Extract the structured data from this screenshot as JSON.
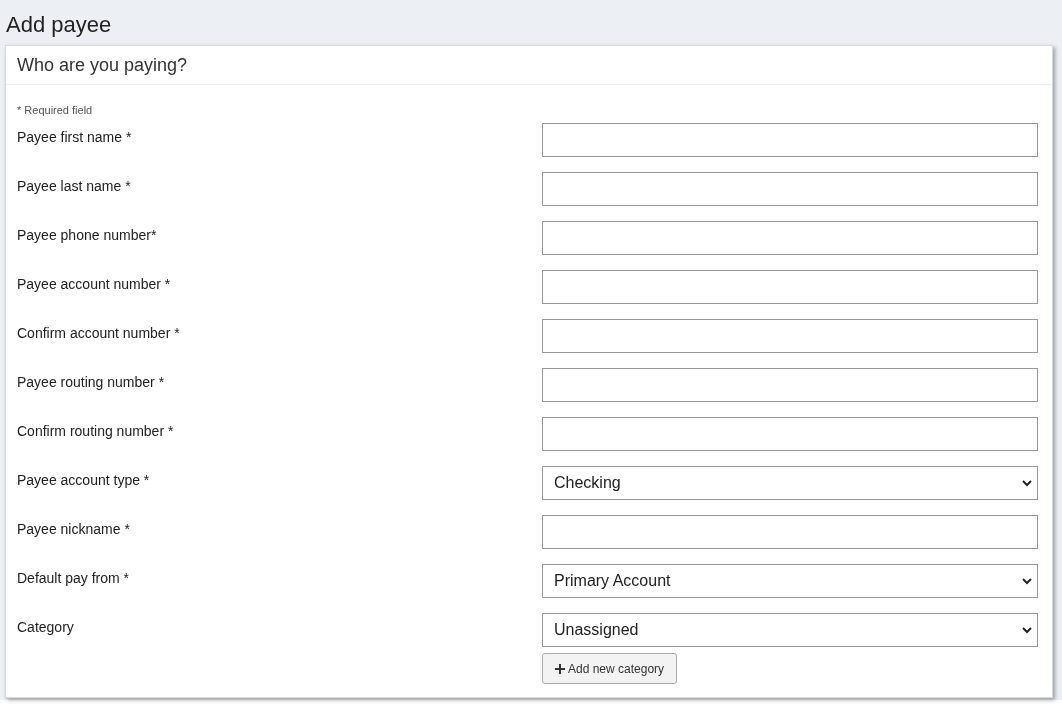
{
  "page": {
    "title": "Add payee"
  },
  "card": {
    "title": "Who are you paying?",
    "note": "* Required field",
    "fields": [
      {
        "label": "Payee first name *",
        "kind": "text"
      },
      {
        "label": "Payee last name *",
        "kind": "text"
      },
      {
        "label": "Payee phone number*",
        "kind": "text"
      },
      {
        "label": "Payee account number *",
        "kind": "text"
      },
      {
        "label": "Confirm account number *",
        "kind": "text"
      },
      {
        "label": "Payee routing number *",
        "kind": "text"
      },
      {
        "label": "Confirm routing number *",
        "kind": "text"
      },
      {
        "label": "Payee account type *",
        "kind": "select",
        "value": "Checking"
      },
      {
        "label": "Payee nickname *",
        "kind": "text"
      },
      {
        "label": "Default pay from *",
        "kind": "select",
        "value": "Primary Account"
      },
      {
        "label": "Category",
        "kind": "select",
        "value": "Unassigned"
      }
    ],
    "button": {
      "label": "Add new category"
    }
  }
}
